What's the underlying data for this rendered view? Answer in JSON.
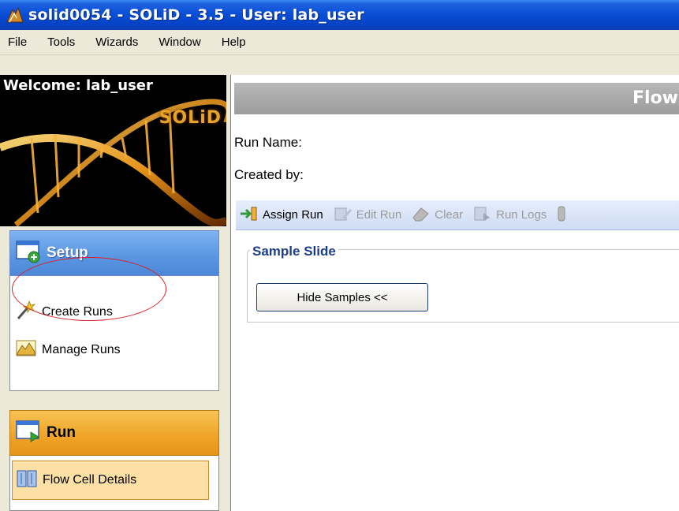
{
  "window": {
    "title": "solid0054 - SOLiD - 3.5 - User: lab_user"
  },
  "menu": [
    "File",
    "Tools",
    "Wizards",
    "Window",
    "Help"
  ],
  "banner": {
    "welcome": "Welcome:  lab_user",
    "logo": "SOLiD"
  },
  "setup": {
    "title": "Setup",
    "items": [
      {
        "label": "Create Runs",
        "icon": "wand-icon"
      },
      {
        "label": "Manage Runs",
        "icon": "mountain-chart-icon"
      }
    ]
  },
  "run": {
    "title": "Run",
    "items": [
      {
        "label": "Flow Cell Details",
        "icon": "flow-cell-icon"
      }
    ]
  },
  "main": {
    "header_title": "Flow",
    "run_name_label": "Run Name:",
    "created_by_label": "Created by:",
    "toolbar": {
      "assign_run": "Assign Run",
      "edit_run": "Edit Run",
      "clear": "Clear",
      "run_logs": "Run Logs"
    },
    "sample_slide": {
      "legend": "Sample Slide",
      "hide_samples_button": "Hide Samples <<"
    }
  },
  "colors": {
    "titlebar": "#0a4fd6",
    "setup_header": "#5b97e3",
    "run_header": "#f0a52a",
    "highlight": "#d81f26",
    "legend_text": "#1c3c8c"
  }
}
